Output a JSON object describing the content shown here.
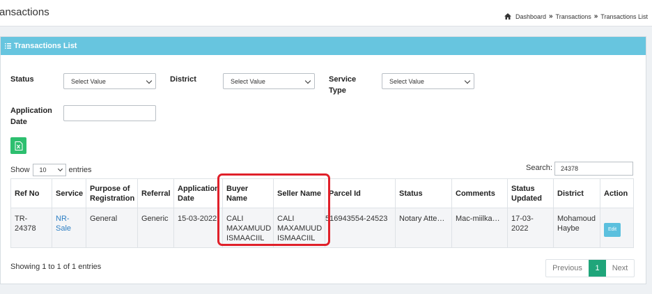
{
  "header": {
    "title": "ransactions",
    "breadcrumb": [
      "Dashboard",
      "Transactions",
      "Transactions List"
    ],
    "sep": "»"
  },
  "card": {
    "title": "Transactions List"
  },
  "filters": {
    "status": {
      "label": "Status",
      "value": "Select Value"
    },
    "district": {
      "label": "District",
      "value": "Select Value"
    },
    "service_type": {
      "label_line1": "Service",
      "label_line2": "Type",
      "value": "Select Value"
    },
    "application_date": {
      "label_line1": "Application",
      "label_line2": "Date",
      "value": ""
    }
  },
  "length_menu": {
    "show": "Show",
    "value": "10",
    "entries": "entries"
  },
  "search": {
    "label": "Search:",
    "value": "24378"
  },
  "table": {
    "columns": [
      "Ref No",
      "Service",
      "Purpose of Registration",
      "Referral",
      "Application Date",
      "Buyer Name",
      "Seller Name",
      "Parcel Id",
      "Status",
      "Comments",
      "Status Updated",
      "District",
      "Action"
    ],
    "rows": [
      {
        "ref_no": "TR-24378",
        "service": "NR-Sale",
        "purpose": "General",
        "referral": "Generic",
        "application_date": "15-03-2022",
        "buyer_name": "CALI MAXAMUUD ISMAACIIL",
        "seller_name": "CALI MAXAMUUD ISMAACIIL",
        "parcel_id": "516943554-24523",
        "status": "Notary Attes…",
        "comments": "Mac-miilkani…",
        "status_updated": "17-03-2022",
        "district": "Mohamoud Haybe",
        "action": "Edit"
      }
    ]
  },
  "info": "Showing 1 to 1 of 1 entries",
  "pagination": {
    "previous": "Previous",
    "current": "1",
    "next": "Next"
  },
  "colors": {
    "header_bar": "#67c5df",
    "excel": "#2dbf6f",
    "pager_active": "#1fa57a",
    "annotation": "#e0202a",
    "link": "#2d7fc4"
  }
}
